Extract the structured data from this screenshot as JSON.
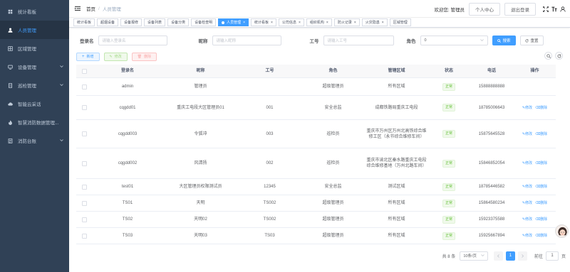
{
  "sidebar": {
    "items": [
      {
        "label": "统计看板",
        "icon": "dashboard-icon",
        "active": false,
        "chevron": false
      },
      {
        "label": "人员管理",
        "icon": "user-icon",
        "active": true,
        "chevron": false
      },
      {
        "label": "区域管理",
        "icon": "area-icon",
        "active": false,
        "chevron": false
      },
      {
        "label": "设备管理",
        "icon": "device-icon",
        "active": false,
        "chevron": true
      },
      {
        "label": "巡检管理",
        "icon": "inspection-icon",
        "active": false,
        "chevron": true
      },
      {
        "label": "智能云采话",
        "icon": "cloud-icon",
        "active": false,
        "chevron": false
      },
      {
        "label": "智慧消防数据管理...",
        "icon": "fire-data-icon",
        "active": false,
        "chevron": false
      },
      {
        "label": "消防台账",
        "icon": "ledger-icon",
        "active": false,
        "chevron": true
      }
    ]
  },
  "header": {
    "breadcrumb": [
      "首页",
      "人员管理"
    ],
    "welcome": "欢迎您: 管理员",
    "personal_center": "个人中心",
    "logout": "退出登录"
  },
  "tags": [
    {
      "label": "统计看板",
      "active": false,
      "close": false
    },
    {
      "label": "超烟设备",
      "active": false,
      "close": false
    },
    {
      "label": "设备报修",
      "active": false,
      "close": false
    },
    {
      "label": "设备列表",
      "active": false,
      "close": false
    },
    {
      "label": "设备分类",
      "active": false,
      "close": false
    },
    {
      "label": "设备检查明",
      "active": false,
      "close": false
    },
    {
      "label": "人员管理",
      "active": true,
      "close": true
    },
    {
      "label": "统计看板",
      "active": false,
      "close": true
    },
    {
      "label": "公司信息",
      "active": false,
      "close": true
    },
    {
      "label": "组织机构",
      "active": false,
      "close": true
    },
    {
      "label": "防火记录",
      "active": false,
      "close": true
    },
    {
      "label": "火灾隐患",
      "active": false,
      "close": true
    },
    {
      "label": "区域管理",
      "active": false,
      "close": false
    }
  ],
  "search": {
    "login_label": "登录名",
    "login_placeholder": "请输入登录名",
    "nick_label": "昵称",
    "nick_placeholder": "请输入昵称",
    "job_label": "工号",
    "job_placeholder": "请输入工号",
    "role_label": "角色",
    "role_value": "0",
    "search_btn": "搜索",
    "reset_btn": "重置"
  },
  "toolbar": {
    "add": "新增",
    "edit": "修改",
    "delete": "删除"
  },
  "table": {
    "columns": [
      "登录名",
      "昵称",
      "工号",
      "角色",
      "管辖区域",
      "状态",
      "电话",
      "操作"
    ],
    "rows": [
      {
        "login": "admin",
        "nick": "管理员",
        "job": "",
        "role": "超级管理员",
        "area": "所有区域",
        "status": "正常",
        "phone": "15888888888",
        "ops": false,
        "h": 25
      },
      {
        "login": "cqgdd01",
        "nick": "重庆工电段大区管理员01",
        "job": "001",
        "role": "安全总监",
        "area": "成都铁路局重庆工电段",
        "status": "正常",
        "phone": "18785006643",
        "ops": true,
        "h": 34
      },
      {
        "login": "cqgdd003",
        "nick": "令狐冲",
        "job": "003",
        "role": "巡检员",
        "area": "重庆市万州区万州北高铁综合维修工区（永节综合维修车间）",
        "status": "正常",
        "phone": "15875645528",
        "ops": true,
        "h": 40
      },
      {
        "login": "cqgdd002",
        "nick": "风清扬",
        "job": "002",
        "role": "巡检员",
        "area": "重庆市渝北区秦水路重庆工电段综合维修基地（万州北路车间）",
        "status": "正常",
        "phone": "15846852054",
        "ops": true,
        "h": 43
      },
      {
        "login": "test01",
        "nick": "大区管理员权限测试员",
        "job": "12345",
        "role": "安全总监",
        "area": "测试区域",
        "status": "正常",
        "phone": "18785446582",
        "ops": true,
        "h": 23
      },
      {
        "login": "TS01",
        "nick": "天明",
        "job": "TS002",
        "role": "超级管理员",
        "area": "所有区域",
        "status": "正常",
        "phone": "15864580234",
        "ops": true,
        "h": 23
      },
      {
        "login": "TS02",
        "nick": "天明02",
        "job": "TS002",
        "role": "超级管理员",
        "area": "所有区域",
        "status": "正常",
        "phone": "15923375588",
        "ops": true,
        "h": 23
      },
      {
        "login": "TS03",
        "nick": "天明03",
        "job": "TS03",
        "role": "超级管理员",
        "area": "所有区域",
        "status": "正常",
        "phone": "15925667894",
        "ops": true,
        "h": 23
      }
    ],
    "edit_label": "修改",
    "delete_label": "删除"
  },
  "pagination": {
    "total": "共 8 条",
    "page_size": "10条/页",
    "current": "1",
    "goto_label": "前往",
    "goto_value": "1",
    "page_suffix": "页"
  },
  "colors": {
    "sidebar_bg": "#304156",
    "primary": "#409eff",
    "success": "#67c23a"
  }
}
